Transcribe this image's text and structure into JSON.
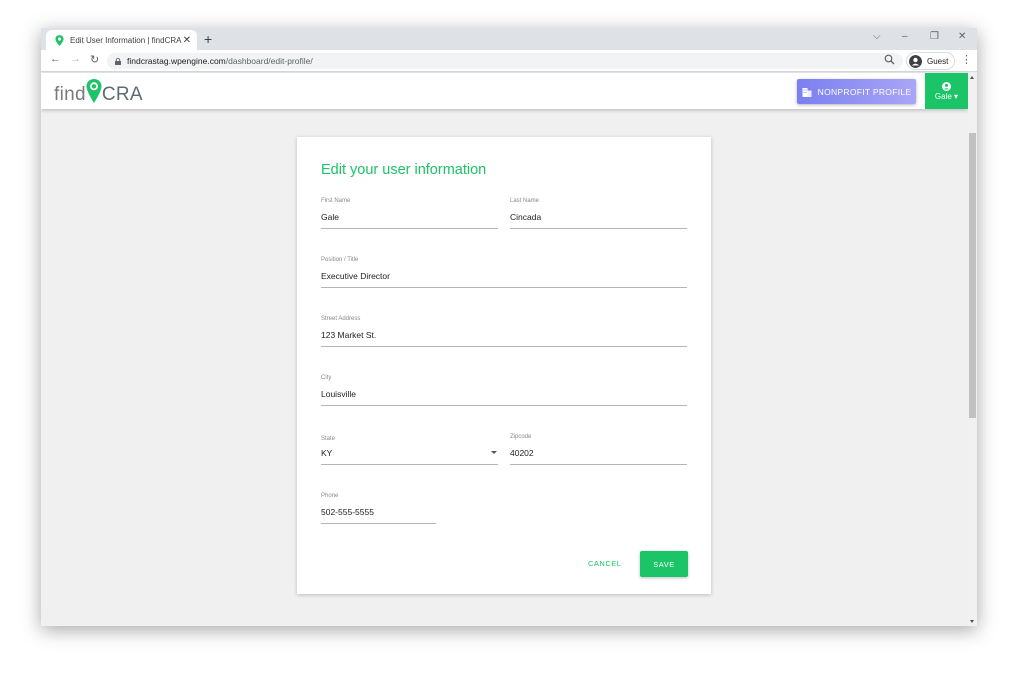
{
  "browser": {
    "tab_title": "Edit User Information | findCRA",
    "tab_close": "✕",
    "new_tab": "+",
    "url_host": "findcrastag.wpengine.com",
    "url_path": "/dashboard/edit-profile/",
    "profile_label": "Guest",
    "controls": {
      "dropdown": "⌵",
      "minimize": "–",
      "restore": "❐",
      "close": "✕"
    },
    "nav": {
      "back": "←",
      "forward": "→",
      "reload": "↻",
      "menu": "⋮"
    }
  },
  "header": {
    "logo_find": "find",
    "logo_cra": "CRA",
    "nonprofit_button": "NONPROFIT PROFILE",
    "user_button": "Gale ▾"
  },
  "form": {
    "title": "Edit your user information",
    "first_name": {
      "label": "First Name",
      "value": "Gale"
    },
    "last_name": {
      "label": "Last Name",
      "value": "Cincada"
    },
    "position": {
      "label": "Position / Title",
      "value": "Executive Director"
    },
    "street": {
      "label": "Street Address",
      "value": "123 Market St."
    },
    "city": {
      "label": "City",
      "value": "Louisville"
    },
    "state": {
      "label": "State",
      "value": "KY"
    },
    "zipcode": {
      "label": "Zipcode",
      "value": "40202"
    },
    "phone": {
      "label": "Phone",
      "value": "502-555-5555"
    },
    "cancel": "CANCEL",
    "save": "SAVE"
  },
  "colors": {
    "brand_green": "#1bc466",
    "nonprofit_gradient_start": "#7b7ff0",
    "nonprofit_gradient_end": "#a9a6f6"
  },
  "icons": [
    "map-pin-icon",
    "lock-icon",
    "zoom-icon",
    "account-icon",
    "building-icon",
    "user-circle-icon"
  ]
}
